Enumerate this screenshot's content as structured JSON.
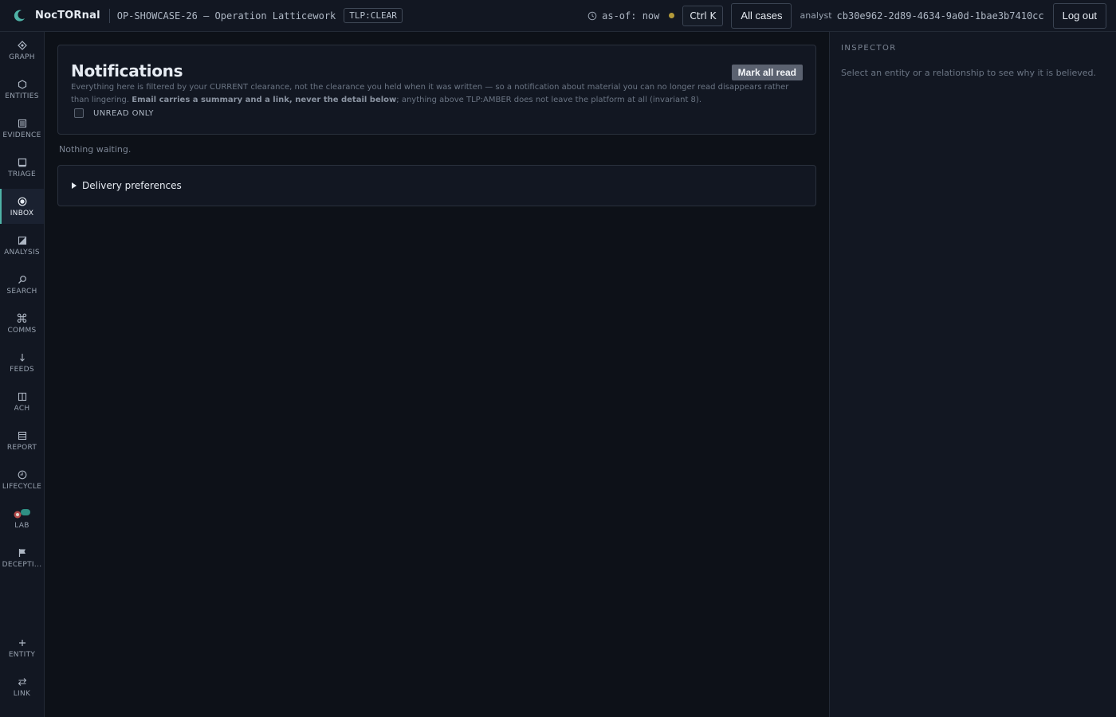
{
  "header": {
    "brand": "NocTORnal",
    "case_name": "OP-SHOWCASE-26 — Operation Latticework",
    "tlp": "TLP:CLEAR",
    "as_of": "as-of: now",
    "shortcut": "Ctrl K",
    "all_cases": "All cases",
    "user_role": "analyst",
    "user_id": "cb30e962-2d89-4634-9a0d-1bae3b7410cc",
    "logout": "Log out",
    "status_color": "#b39a3a",
    "accent": "#4fb3a7"
  },
  "rail": {
    "items": [
      {
        "label": "GRAPH",
        "icon": "graph-icon"
      },
      {
        "label": "ENTITIES",
        "icon": "hexagon-icon"
      },
      {
        "label": "EVIDENCE",
        "icon": "document-icon"
      },
      {
        "label": "TRIAGE",
        "icon": "square-icon"
      },
      {
        "label": "INBOX",
        "icon": "inbox-dot-icon",
        "active": true
      },
      {
        "label": "ANALYSIS",
        "icon": "analysis-icon"
      },
      {
        "label": "SEARCH",
        "icon": "search-icon"
      },
      {
        "label": "COMMS",
        "icon": "command-icon"
      },
      {
        "label": "FEEDS",
        "icon": "down-arrow-icon"
      },
      {
        "label": "ACH",
        "icon": "columns-icon"
      },
      {
        "label": "REPORT",
        "icon": "report-icon"
      },
      {
        "label": "LIFECYCLE",
        "icon": "clock-icon"
      },
      {
        "label": "LAB",
        "icon": "lab-icon"
      },
      {
        "label": "DECEPTI...",
        "icon": "flag-icon"
      }
    ],
    "bottom": [
      {
        "label": "ENTITY",
        "icon": "plus-icon"
      },
      {
        "label": "LINK",
        "icon": "swap-icon"
      }
    ]
  },
  "notifications": {
    "title": "Notifications",
    "mark_all_read": "Mark all read",
    "desc_pre": "Everything here is filtered by your CURRENT clearance, not the clearance you held when it was written — so a notification about material you can no longer read disappears rather than lingering. ",
    "desc_bold": "Email carries a summary and a link, never the detail below",
    "desc_post": "; anything above TLP:AMBER does not leave the platform at all (invariant 8).",
    "unread_only": "UNREAD ONLY",
    "unread_checked": false,
    "empty": "Nothing waiting.",
    "delivery_prefs": "Delivery preferences"
  },
  "inspector": {
    "title": "INSPECTOR",
    "hint": "Select an entity or a relationship to see why it is believed."
  }
}
